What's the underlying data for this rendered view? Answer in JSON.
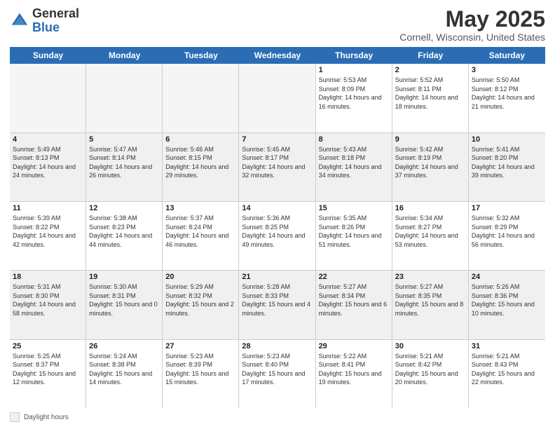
{
  "header": {
    "logo_general": "General",
    "logo_blue": "Blue",
    "month_title": "May 2025",
    "location": "Cornell, Wisconsin, United States"
  },
  "weekdays": [
    "Sunday",
    "Monday",
    "Tuesday",
    "Wednesday",
    "Thursday",
    "Friday",
    "Saturday"
  ],
  "legend": {
    "box_label": "Daylight hours"
  },
  "weeks": [
    [
      {
        "day": "",
        "sunrise": "",
        "sunset": "",
        "daylight": "",
        "empty": true
      },
      {
        "day": "",
        "sunrise": "",
        "sunset": "",
        "daylight": "",
        "empty": true
      },
      {
        "day": "",
        "sunrise": "",
        "sunset": "",
        "daylight": "",
        "empty": true
      },
      {
        "day": "",
        "sunrise": "",
        "sunset": "",
        "daylight": "",
        "empty": true
      },
      {
        "day": "1",
        "sunrise": "Sunrise: 5:53 AM",
        "sunset": "Sunset: 8:09 PM",
        "daylight": "Daylight: 14 hours and 16 minutes.",
        "empty": false
      },
      {
        "day": "2",
        "sunrise": "Sunrise: 5:52 AM",
        "sunset": "Sunset: 8:11 PM",
        "daylight": "Daylight: 14 hours and 18 minutes.",
        "empty": false
      },
      {
        "day": "3",
        "sunrise": "Sunrise: 5:50 AM",
        "sunset": "Sunset: 8:12 PM",
        "daylight": "Daylight: 14 hours and 21 minutes.",
        "empty": false
      }
    ],
    [
      {
        "day": "4",
        "sunrise": "Sunrise: 5:49 AM",
        "sunset": "Sunset: 8:13 PM",
        "daylight": "Daylight: 14 hours and 24 minutes.",
        "empty": false
      },
      {
        "day": "5",
        "sunrise": "Sunrise: 5:47 AM",
        "sunset": "Sunset: 8:14 PM",
        "daylight": "Daylight: 14 hours and 26 minutes.",
        "empty": false
      },
      {
        "day": "6",
        "sunrise": "Sunrise: 5:46 AM",
        "sunset": "Sunset: 8:15 PM",
        "daylight": "Daylight: 14 hours and 29 minutes.",
        "empty": false
      },
      {
        "day": "7",
        "sunrise": "Sunrise: 5:45 AM",
        "sunset": "Sunset: 8:17 PM",
        "daylight": "Daylight: 14 hours and 32 minutes.",
        "empty": false
      },
      {
        "day": "8",
        "sunrise": "Sunrise: 5:43 AM",
        "sunset": "Sunset: 8:18 PM",
        "daylight": "Daylight: 14 hours and 34 minutes.",
        "empty": false
      },
      {
        "day": "9",
        "sunrise": "Sunrise: 5:42 AM",
        "sunset": "Sunset: 8:19 PM",
        "daylight": "Daylight: 14 hours and 37 minutes.",
        "empty": false
      },
      {
        "day": "10",
        "sunrise": "Sunrise: 5:41 AM",
        "sunset": "Sunset: 8:20 PM",
        "daylight": "Daylight: 14 hours and 39 minutes.",
        "empty": false
      }
    ],
    [
      {
        "day": "11",
        "sunrise": "Sunrise: 5:39 AM",
        "sunset": "Sunset: 8:22 PM",
        "daylight": "Daylight: 14 hours and 42 minutes.",
        "empty": false
      },
      {
        "day": "12",
        "sunrise": "Sunrise: 5:38 AM",
        "sunset": "Sunset: 8:23 PM",
        "daylight": "Daylight: 14 hours and 44 minutes.",
        "empty": false
      },
      {
        "day": "13",
        "sunrise": "Sunrise: 5:37 AM",
        "sunset": "Sunset: 8:24 PM",
        "daylight": "Daylight: 14 hours and 46 minutes.",
        "empty": false
      },
      {
        "day": "14",
        "sunrise": "Sunrise: 5:36 AM",
        "sunset": "Sunset: 8:25 PM",
        "daylight": "Daylight: 14 hours and 49 minutes.",
        "empty": false
      },
      {
        "day": "15",
        "sunrise": "Sunrise: 5:35 AM",
        "sunset": "Sunset: 8:26 PM",
        "daylight": "Daylight: 14 hours and 51 minutes.",
        "empty": false
      },
      {
        "day": "16",
        "sunrise": "Sunrise: 5:34 AM",
        "sunset": "Sunset: 8:27 PM",
        "daylight": "Daylight: 14 hours and 53 minutes.",
        "empty": false
      },
      {
        "day": "17",
        "sunrise": "Sunrise: 5:32 AM",
        "sunset": "Sunset: 8:29 PM",
        "daylight": "Daylight: 14 hours and 56 minutes.",
        "empty": false
      }
    ],
    [
      {
        "day": "18",
        "sunrise": "Sunrise: 5:31 AM",
        "sunset": "Sunset: 8:30 PM",
        "daylight": "Daylight: 14 hours and 58 minutes.",
        "empty": false
      },
      {
        "day": "19",
        "sunrise": "Sunrise: 5:30 AM",
        "sunset": "Sunset: 8:31 PM",
        "daylight": "Daylight: 15 hours and 0 minutes.",
        "empty": false
      },
      {
        "day": "20",
        "sunrise": "Sunrise: 5:29 AM",
        "sunset": "Sunset: 8:32 PM",
        "daylight": "Daylight: 15 hours and 2 minutes.",
        "empty": false
      },
      {
        "day": "21",
        "sunrise": "Sunrise: 5:28 AM",
        "sunset": "Sunset: 8:33 PM",
        "daylight": "Daylight: 15 hours and 4 minutes.",
        "empty": false
      },
      {
        "day": "22",
        "sunrise": "Sunrise: 5:27 AM",
        "sunset": "Sunset: 8:34 PM",
        "daylight": "Daylight: 15 hours and 6 minutes.",
        "empty": false
      },
      {
        "day": "23",
        "sunrise": "Sunrise: 5:27 AM",
        "sunset": "Sunset: 8:35 PM",
        "daylight": "Daylight: 15 hours and 8 minutes.",
        "empty": false
      },
      {
        "day": "24",
        "sunrise": "Sunrise: 5:26 AM",
        "sunset": "Sunset: 8:36 PM",
        "daylight": "Daylight: 15 hours and 10 minutes.",
        "empty": false
      }
    ],
    [
      {
        "day": "25",
        "sunrise": "Sunrise: 5:25 AM",
        "sunset": "Sunset: 8:37 PM",
        "daylight": "Daylight: 15 hours and 12 minutes.",
        "empty": false
      },
      {
        "day": "26",
        "sunrise": "Sunrise: 5:24 AM",
        "sunset": "Sunset: 8:38 PM",
        "daylight": "Daylight: 15 hours and 14 minutes.",
        "empty": false
      },
      {
        "day": "27",
        "sunrise": "Sunrise: 5:23 AM",
        "sunset": "Sunset: 8:39 PM",
        "daylight": "Daylight: 15 hours and 15 minutes.",
        "empty": false
      },
      {
        "day": "28",
        "sunrise": "Sunrise: 5:23 AM",
        "sunset": "Sunset: 8:40 PM",
        "daylight": "Daylight: 15 hours and 17 minutes.",
        "empty": false
      },
      {
        "day": "29",
        "sunrise": "Sunrise: 5:22 AM",
        "sunset": "Sunset: 8:41 PM",
        "daylight": "Daylight: 15 hours and 19 minutes.",
        "empty": false
      },
      {
        "day": "30",
        "sunrise": "Sunrise: 5:21 AM",
        "sunset": "Sunset: 8:42 PM",
        "daylight": "Daylight: 15 hours and 20 minutes.",
        "empty": false
      },
      {
        "day": "31",
        "sunrise": "Sunrise: 5:21 AM",
        "sunset": "Sunset: 8:43 PM",
        "daylight": "Daylight: 15 hours and 22 minutes.",
        "empty": false
      }
    ]
  ]
}
